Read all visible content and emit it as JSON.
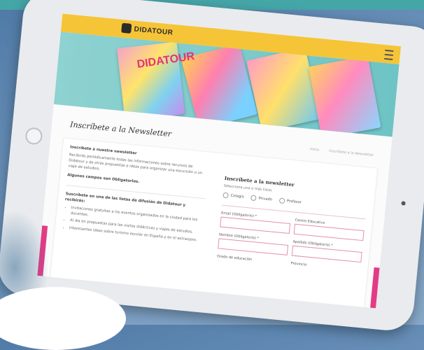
{
  "header": {
    "brand": "DIDATOUR"
  },
  "hero": {
    "word": "DIDATOUR"
  },
  "page": {
    "title": "Inscríbete a la Newsletter",
    "breadcrumbs": [
      "Inicio",
      "Inscríbete a la Newsletter"
    ]
  },
  "left": {
    "heading": "Inscríbete a nuestra newsletter",
    "intro": "Recibirás periódicamente todas las informaciones sobre recursos de Didatour y de otras propuestas e ideas para organizar una excursión o un viaje de estudios.",
    "required_note": "Algunos campos son Obligatorios.",
    "list_heading": "Suscríbete en una de las listas de difusión de Didatour y recibirás:",
    "bullets": [
      "Invitaciones gratuitas a los eventos organizados en la ciudad para los docentes.",
      "Al día en propuestas para las visitas didácticas y viajes de estudios.",
      "Interesantes ideas sobre turismo escolar en España y en el extranjero."
    ]
  },
  "right": {
    "heading": "Inscríbete a la newsletter",
    "subtitle": "Selecciona una o más listas",
    "options": [
      "Colegio",
      "Privado",
      "Profesor"
    ],
    "fields": {
      "email": "Email (Obligatorio) *",
      "centro": "Centro Educativo",
      "nombre": "Nombre (Obligatorio) *",
      "apellido": "Apellido (Obligatorio) *",
      "nivel": "Grado de educación",
      "provincia": "Provincia"
    }
  }
}
